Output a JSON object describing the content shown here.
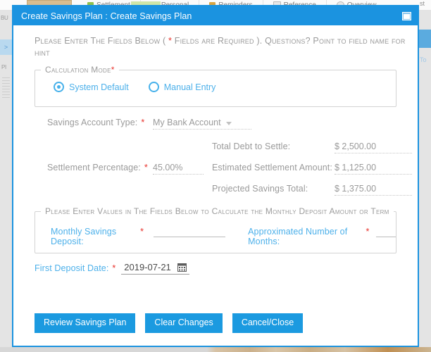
{
  "background": {
    "toolbar_items": [
      {
        "label": "Settlement",
        "icon": "document-icon"
      },
      {
        "label": "Personal",
        "icon": "folder-icon"
      },
      {
        "label": "Reminders",
        "icon": "people-icon"
      },
      {
        "label": "Reference",
        "icon": "page-icon"
      },
      {
        "label": "Overview",
        "icon": "circle-icon"
      }
    ],
    "left_rail_top": "BU",
    "left_rail_selected": ">",
    "left_rail_lower": "PI",
    "right_rail_top": "st",
    "right_rail_text": "To"
  },
  "dialog": {
    "title": "Create Savings Plan : Create Savings Plan",
    "window_button": "restore-window-icon",
    "accent_color": "#1b93e0",
    "instructions": {
      "before_star": "Please Enter The Fields Below ( ",
      "star": "*",
      "after_star": " Fields are Required ). Questions? Point to field name for hint"
    },
    "calculation_mode": {
      "legend": "Calculation Mode",
      "required": "*",
      "options": [
        {
          "label": "System Default",
          "selected": true
        },
        {
          "label": "Manual Entry",
          "selected": false
        }
      ]
    },
    "fields": {
      "savings_account_type": {
        "label": "Savings Account Type:",
        "required": "*",
        "value": "My Bank Account"
      },
      "settlement_percentage": {
        "label": "Settlement Percentage:",
        "required": "*",
        "value": "45.00%"
      },
      "total_debt_to_settle": {
        "label": "Total Debt to Settle:",
        "value": "$ 2,500.00"
      },
      "estimated_settlement_amount": {
        "label": "Estimated Settlement Amount:",
        "value": "$ 1,125.00"
      },
      "projected_savings_total": {
        "label": "Projected Savings Total:",
        "value": "$ 1,375.00"
      }
    },
    "deposit_section": {
      "legend": "Please Enter Values in The Fields Below to Calculate the Monthly Deposit Amount or Term",
      "monthly_savings_deposit": {
        "label": "Monthly Savings Deposit:",
        "required": "*",
        "value": "",
        "placeholder": ""
      },
      "approximated_months": {
        "label": "Approximated Number of Months:",
        "required": "*",
        "value": "",
        "placeholder": ""
      }
    },
    "first_deposit_date": {
      "label": "First Deposit Date:",
      "required": "*",
      "value": "2019-07-21",
      "icon": "calendar-icon"
    },
    "buttons": [
      {
        "label": "Review Savings Plan",
        "name": "review-savings-plan-button"
      },
      {
        "label": "Clear Changes",
        "name": "clear-changes-button"
      },
      {
        "label": "Cancel/Close",
        "name": "cancel-close-button"
      }
    ]
  }
}
